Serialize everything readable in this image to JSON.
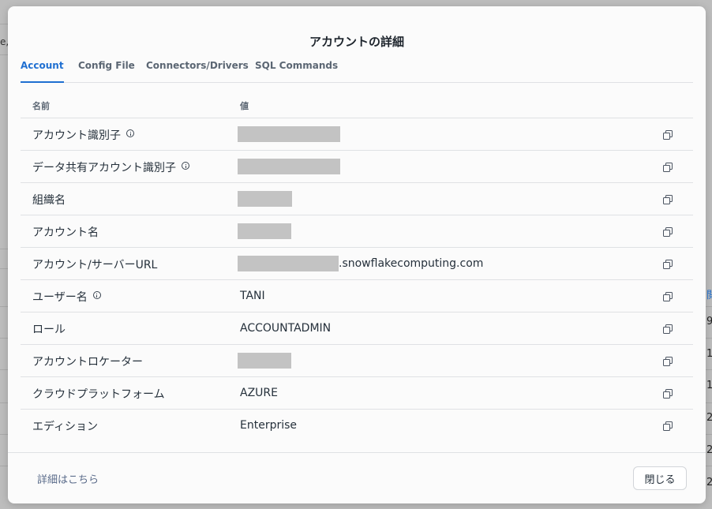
{
  "background": {
    "left_fragment": "e,",
    "right_cells": [
      "閲",
      "9",
      "1",
      "1",
      "2",
      "2",
      "2"
    ]
  },
  "modal": {
    "title": "アカウントの詳細",
    "tabs": [
      {
        "label": "Account",
        "active": true
      },
      {
        "label": "Config File",
        "active": false
      },
      {
        "label": "Connectors/Drivers",
        "active": false
      },
      {
        "label": "SQL Commands",
        "active": false
      }
    ],
    "table": {
      "headers": {
        "name": "名前",
        "value": "値"
      },
      "rows": [
        {
          "name": "アカウント識別子",
          "info": true,
          "value": "",
          "redacted": true,
          "suffix": ""
        },
        {
          "name": "データ共有アカウント識別子",
          "info": true,
          "value": "",
          "redacted": true,
          "suffix": ""
        },
        {
          "name": "組織名",
          "info": false,
          "value": "",
          "redacted": true,
          "suffix": ""
        },
        {
          "name": "アカウント名",
          "info": false,
          "value": "",
          "redacted": true,
          "suffix": ""
        },
        {
          "name": "アカウント/サーバーURL",
          "info": false,
          "value": "",
          "redacted": true,
          "suffix": ".snowflakecomputing.com"
        },
        {
          "name": "ユーザー名",
          "info": true,
          "value": "TANI",
          "redacted": false,
          "suffix": ""
        },
        {
          "name": "ロール",
          "info": false,
          "value": "ACCOUNTADMIN",
          "redacted": false,
          "suffix": ""
        },
        {
          "name": "アカウントロケーター",
          "info": false,
          "value": "",
          "redacted": true,
          "suffix": ""
        },
        {
          "name": "クラウドプラットフォーム",
          "info": false,
          "value": "AZURE",
          "redacted": false,
          "suffix": ""
        },
        {
          "name": "エディション",
          "info": false,
          "value": "Enterprise",
          "redacted": false,
          "suffix": ""
        }
      ]
    },
    "footer": {
      "link_label": "詳細はこちら",
      "close_label": "閉じる"
    }
  },
  "colors": {
    "accent": "#1f6fd1",
    "backdrop": "#bdbdbd",
    "redaction": "#c3c3c3"
  }
}
